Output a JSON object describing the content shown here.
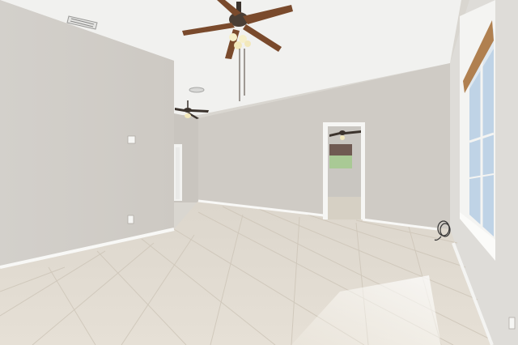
{
  "scene": {
    "description_visible_text": "",
    "palette": {
      "ceiling": "#f1f1ef",
      "wall_left": "#d4d0ca",
      "wall_back": "#cfcbc5",
      "wall_right": "#dcdad6",
      "floor": "#e3ddd2",
      "grout": "#cfc7ba",
      "baseboard": "#f7f7f5",
      "fan_wood": "#7a4a2c",
      "fan_metal": "#3b332d",
      "window_sky": "#bfd3e6",
      "window_trim": "#f4f4f2",
      "blind": "#b08050",
      "sunlight": "#fbf8f1"
    },
    "objects": [
      "ceiling-fan-main",
      "ceiling-fan-distant",
      "ceiling-fan-next-room",
      "doorway-back-wall",
      "doorway-left-wall",
      "window-right-wall",
      "air-vent",
      "outlet-left-wall",
      "light-switch",
      "cable-coil"
    ]
  }
}
